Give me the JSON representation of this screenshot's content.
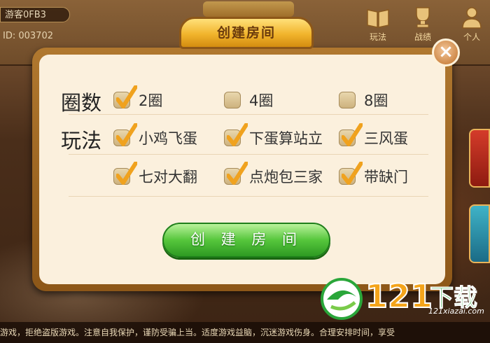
{
  "header": {
    "player_name": "游客0FB3",
    "player_id": "ID: 003702",
    "icons": [
      {
        "name": "book-icon",
        "label": "玩法"
      },
      {
        "name": "trophy-icon",
        "label": "战绩"
      },
      {
        "name": "person-icon",
        "label": "个人"
      }
    ]
  },
  "modal": {
    "title": "创建房间",
    "close_symbol": "×",
    "rounds": {
      "label": "圈数",
      "options": [
        {
          "text": "2圈",
          "checked": true
        },
        {
          "text": "4圈",
          "checked": false
        },
        {
          "text": "8圈",
          "checked": false
        }
      ]
    },
    "rules": {
      "label": "玩法",
      "options": [
        {
          "text": "小鸡飞蛋",
          "checked": true
        },
        {
          "text": "下蛋算站立",
          "checked": true
        },
        {
          "text": "三风蛋",
          "checked": true
        },
        {
          "text": "七对大翻",
          "checked": true
        },
        {
          "text": "点炮包三家",
          "checked": true
        },
        {
          "text": "带缺门",
          "checked": true
        }
      ]
    },
    "create_button": "创 建 房 间"
  },
  "ticker": "游戏，拒绝盗版游戏。注意自我保护，谨防受骗上当。适度游戏益脑，沉迷游戏伤身。合理安排时间，享受",
  "watermark": {
    "number": "121",
    "chinese": "下载",
    "url": "121xiazai.com"
  },
  "colors": {
    "check_orange": "#f0a21e",
    "button_green": "#56c63c",
    "title_gold": "#f1b42c",
    "panel_cream": "#fbf0dd"
  }
}
